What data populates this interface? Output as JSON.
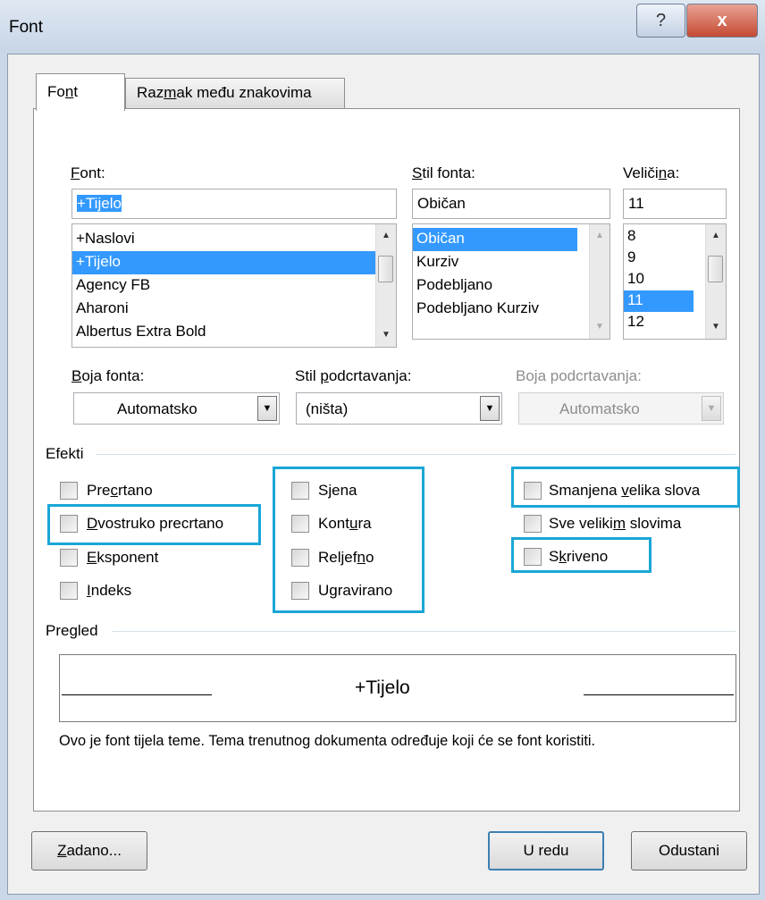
{
  "window": {
    "title": "Font",
    "help_icon": "?",
    "close_icon": "x"
  },
  "tabs": [
    {
      "label_pre": "Fo",
      "label_u": "n",
      "label_post": "t"
    },
    {
      "label_pre": "Raz",
      "label_u": "m",
      "label_post": "ak među znakovima"
    }
  ],
  "font": {
    "label_pre": "",
    "label_u": "F",
    "label_post": "ont:",
    "value": "+Tijelo",
    "items": [
      "+Naslovi",
      "+Tijelo",
      "Agency FB",
      "Aharoni",
      "Albertus Extra Bold"
    ],
    "selected_index": 1
  },
  "style": {
    "label_pre": "",
    "label_u": "S",
    "label_post": "til fonta:",
    "value": "Običan",
    "items": [
      "Običan",
      "Kurziv",
      "Podebljano",
      "Podebljano Kurziv"
    ],
    "selected_index": 0
  },
  "size": {
    "label_pre": "Veliči",
    "label_u": "n",
    "label_post": "a:",
    "value": "11",
    "items": [
      "8",
      "9",
      "10",
      "11",
      "12"
    ],
    "selected_index": 3
  },
  "font_color": {
    "label_pre": "",
    "label_u": "B",
    "label_post": "oja fonta:",
    "value": "Automatsko"
  },
  "underline_style": {
    "label_pre": "Stil ",
    "label_u": "p",
    "label_post": "odcrtavanja:",
    "value": "(ništa)"
  },
  "underline_color": {
    "label": "Boja podcrtavanja:",
    "value": "Automatsko"
  },
  "effects": {
    "title": "Efekti",
    "items": [
      {
        "pre": "Pre",
        "u": "c",
        "post": "rtano"
      },
      {
        "pre": "",
        "u": "D",
        "post": "vostruko precrtano"
      },
      {
        "pre": "",
        "u": "E",
        "post": "ksponent"
      },
      {
        "pre": "",
        "u": "I",
        "post": "ndeks"
      },
      {
        "pre": "S",
        "u": "j",
        "post": "ena"
      },
      {
        "pre": "Kont",
        "u": "u",
        "post": "ra"
      },
      {
        "pre": "Reljef",
        "u": "n",
        "post": "o"
      },
      {
        "pre": "U",
        "u": "g",
        "post": "ravirano"
      },
      {
        "pre": "Smanjena ",
        "u": "v",
        "post": "elika slova"
      },
      {
        "pre": "Sve veliki",
        "u": "m",
        "post": " slovima"
      },
      {
        "pre": "S",
        "u": "k",
        "post": "riveno"
      }
    ]
  },
  "preview": {
    "title": "Pregled",
    "sample": "+Tijelo",
    "description": "Ovo je font tijela teme. Tema trenutnog dokumenta određuje koji će se font koristiti."
  },
  "buttons": {
    "default": {
      "pre": "",
      "u": "Z",
      "post": "adano..."
    },
    "ok": "U redu",
    "cancel": "Odustani"
  }
}
